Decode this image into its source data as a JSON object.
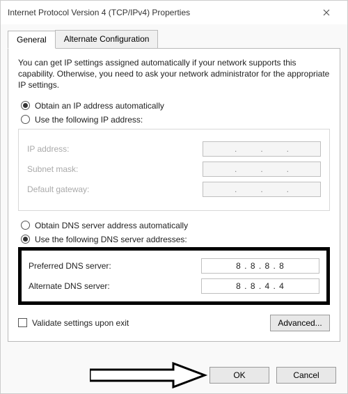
{
  "window": {
    "title": "Internet Protocol Version 4 (TCP/IPv4) Properties"
  },
  "tabs": {
    "general": "General",
    "alternate": "Alternate Configuration"
  },
  "description": "You can get IP settings assigned automatically if your network supports this capability. Otherwise, you need to ask your network administrator for the appropriate IP settings.",
  "ip_section": {
    "obtain_auto": "Obtain an IP address automatically",
    "use_following": "Use the following IP address:",
    "ip_address_label": "IP address:",
    "subnet_label": "Subnet mask:",
    "gateway_label": "Default gateway:"
  },
  "dns_section": {
    "obtain_auto": "Obtain DNS server address automatically",
    "use_following": "Use the following DNS server addresses:",
    "preferred_label": "Preferred DNS server:",
    "alternate_label": "Alternate DNS server:",
    "preferred_value": "8 . 8 . 8 . 8",
    "alternate_value": "8 . 8 . 4 . 4"
  },
  "validate_label": "Validate settings upon exit",
  "buttons": {
    "advanced": "Advanced...",
    "ok": "OK",
    "cancel": "Cancel"
  }
}
